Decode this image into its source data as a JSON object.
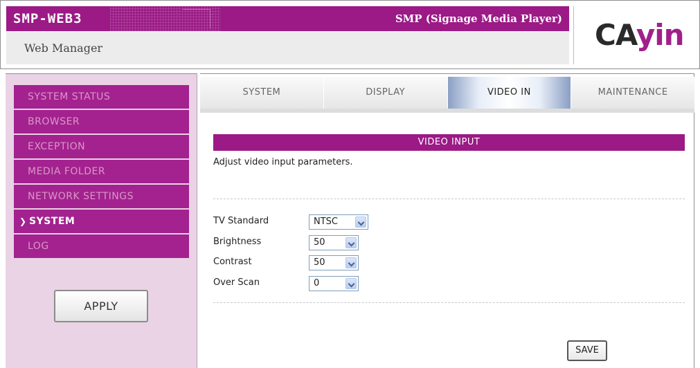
{
  "header": {
    "product_name": "SMP-WEB3",
    "product_description": "SMP (Signage Media Player)",
    "subtitle": "Web Manager",
    "logo": {
      "part1": "CA",
      "part2": "yin"
    }
  },
  "sidebar": {
    "items": [
      {
        "label": "SYSTEM STATUS",
        "active": false
      },
      {
        "label": "BROWSER",
        "active": false
      },
      {
        "label": "EXCEPTION",
        "active": false
      },
      {
        "label": "MEDIA FOLDER",
        "active": false
      },
      {
        "label": "NETWORK SETTINGS",
        "active": false
      },
      {
        "label": "SYSTEM",
        "active": true
      },
      {
        "label": "LOG",
        "active": false
      }
    ],
    "apply_label": "APPLY"
  },
  "tabs": [
    {
      "label": "SYSTEM",
      "active": false
    },
    {
      "label": "DISPLAY",
      "active": false
    },
    {
      "label": "VIDEO IN",
      "active": true
    },
    {
      "label": "MAINTENANCE",
      "active": false
    }
  ],
  "section": {
    "title": "VIDEO INPUT",
    "description": "Adjust video input parameters."
  },
  "form": {
    "tv_standard": {
      "label": "TV Standard",
      "value": "NTSC"
    },
    "brightness": {
      "label": "Brightness",
      "value": "50"
    },
    "contrast": {
      "label": "Contrast",
      "value": "50"
    },
    "over_scan": {
      "label": "Over Scan",
      "value": "0"
    }
  },
  "save_label": "SAVE",
  "colors": {
    "brand_purple": "#9b1a86",
    "sidebar_bg": "#e9d3e5",
    "inactive_menu_text": "#d997c7"
  }
}
